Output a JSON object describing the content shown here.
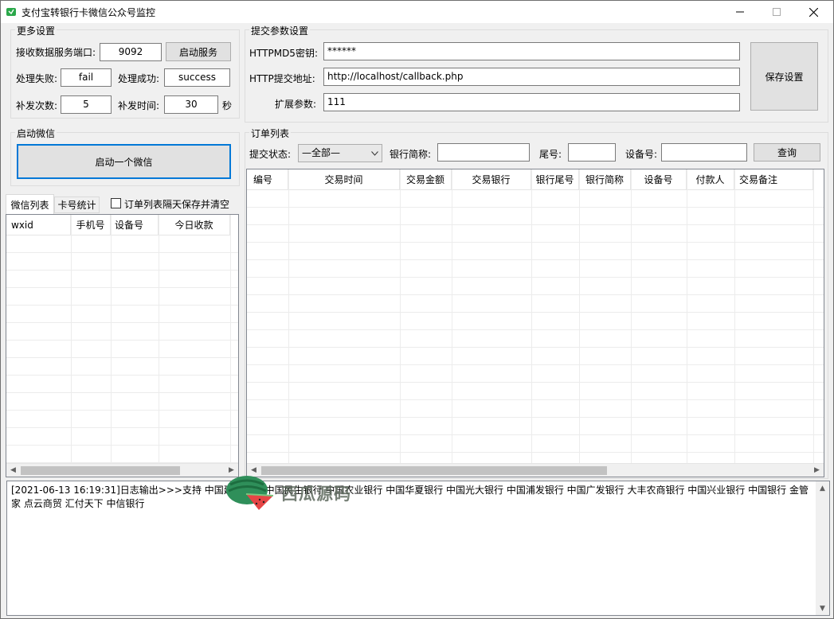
{
  "window": {
    "title": "支付宝转银行卡微信公众号监控"
  },
  "more_settings": {
    "title": "更多设置",
    "port_label": "接收数据服务端口:",
    "port_value": "9092",
    "start_service_label": "启动服务",
    "fail_label": "处理失败:",
    "fail_value": "fail",
    "success_label": "处理成功:",
    "success_value": "success",
    "retry_count_label": "补发次数:",
    "retry_count_value": "5",
    "retry_time_label": "补发时间:",
    "retry_time_value": "30",
    "retry_time_unit": "秒"
  },
  "submit_settings": {
    "title": "提交参数设置",
    "md5_label": "HTTPMD5密钥:",
    "md5_value": "******",
    "url_label": "HTTP提交地址:",
    "url_value": "http://localhost/callback.php",
    "ext_label": "扩展参数:",
    "ext_value": "111",
    "save_label": "保存设置"
  },
  "start_wechat": {
    "title": "启动微信",
    "button_label": "启动一个微信"
  },
  "tabs": {
    "items": [
      "微信列表",
      "卡号统计"
    ],
    "clear_checkbox_label": "订单列表隔天保存并清空"
  },
  "wechat_grid": {
    "columns": [
      "wxid",
      "手机号",
      "设备号",
      "今日收款"
    ]
  },
  "order_list": {
    "title": "订单列表",
    "status_label": "提交状态:",
    "status_value": "—全部—",
    "bank_short_label": "银行简称:",
    "bank_short_value": "",
    "tail_label": "尾号:",
    "tail_value": "",
    "device_label": "设备号:",
    "device_value": "",
    "query_label": "查询",
    "columns": [
      "编号",
      "交易时间",
      "交易金额",
      "交易银行",
      "银行尾号",
      "银行简称",
      "设备号",
      "付款人",
      "交易备注"
    ]
  },
  "log": {
    "text": "[2021-06-13 16:19:31]日志输出>>>支持 中国建设银行 中国民生银行 中国农业银行 中国华夏银行 中国光大银行 中国浦发银行 中国广发银行 大丰农商银行 中国兴业银行 中国银行 金管家 点云商贸 汇付天下 中信银行"
  },
  "watermark": {
    "text": "西瓜源码"
  }
}
